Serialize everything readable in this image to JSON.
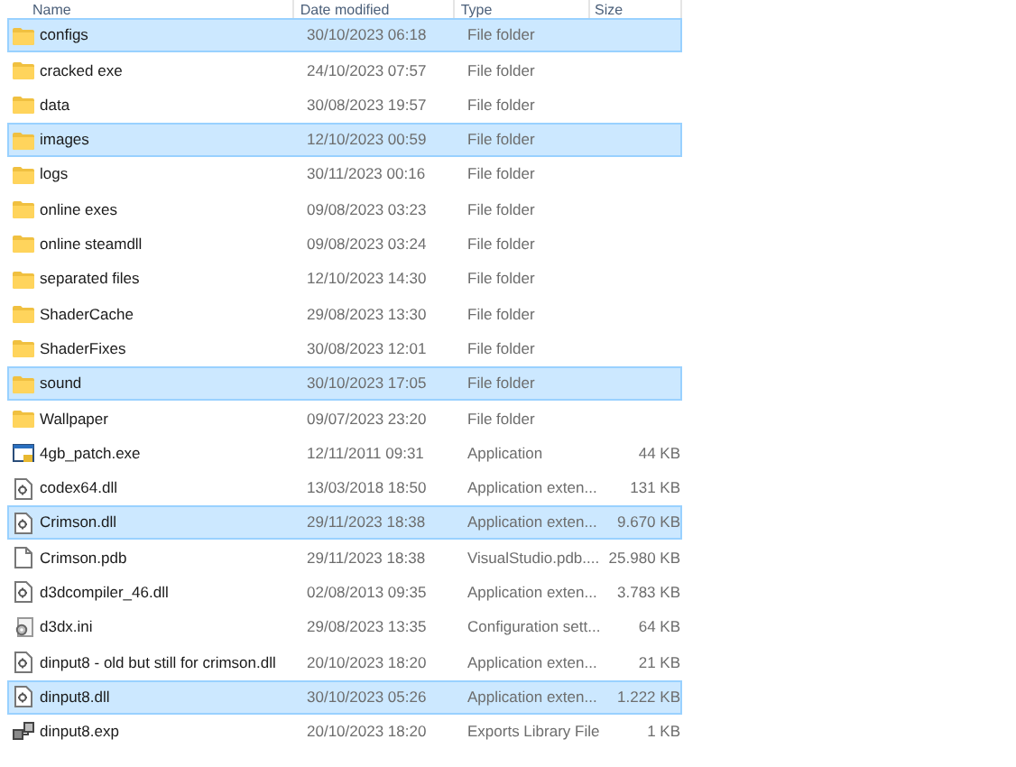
{
  "columns": [
    "Name",
    "Date modified",
    "Type",
    "Size"
  ],
  "rows": [
    {
      "kind": "folder",
      "name": "configs",
      "date": "30/10/2023 06:18",
      "type": "File folder",
      "selected": true
    },
    {
      "kind": "folder",
      "name": "cracked exe",
      "date": "24/10/2023 07:57",
      "type": "File folder",
      "selected": false
    },
    {
      "kind": "folder",
      "name": "data",
      "date": "30/08/2023 19:57",
      "type": "File folder",
      "selected": false
    },
    {
      "kind": "folder",
      "name": "images",
      "date": "12/10/2023 00:59",
      "type": "File folder",
      "selected": true
    },
    {
      "kind": "folder",
      "name": "logs",
      "date": "30/11/2023 00:16",
      "type": "File folder",
      "selected": false
    },
    {
      "kind": "folder",
      "name": "online exes",
      "date": "09/08/2023 03:23",
      "type": "File folder",
      "selected": false
    },
    {
      "kind": "folder",
      "name": "online steamdll",
      "date": "09/08/2023 03:24",
      "type": "File folder",
      "selected": false
    },
    {
      "kind": "folder",
      "name": "separated files",
      "date": "12/10/2023 14:30",
      "type": "File folder",
      "selected": false
    },
    {
      "kind": "folder",
      "name": "ShaderCache",
      "date": "29/08/2023 13:30",
      "type": "File folder",
      "selected": false
    },
    {
      "kind": "folder",
      "name": "ShaderFixes",
      "date": "30/08/2023 12:01",
      "type": "File folder",
      "selected": false
    },
    {
      "kind": "folder",
      "name": "sound",
      "date": "30/10/2023 17:05",
      "type": "File folder",
      "selected": true
    },
    {
      "kind": "folder",
      "name": "Wallpaper",
      "date": "09/07/2023 23:20",
      "type": "File folder",
      "selected": false
    },
    {
      "kind": "application",
      "name": "4gb_patch.exe",
      "date": "12/11/2011 09:31",
      "type": "Application",
      "size": "44 KB",
      "selected": false
    },
    {
      "kind": "dll",
      "name": "codex64.dll",
      "date": "13/03/2018 18:50",
      "type": "Application exten...",
      "size": "131 KB",
      "selected": false
    },
    {
      "kind": "dll",
      "name": "Crimson.dll",
      "date": "29/11/2023 18:38",
      "type": "Application exten...",
      "size": "9.670 KB",
      "selected": true
    },
    {
      "kind": "file",
      "name": "Crimson.pdb",
      "date": "29/11/2023 18:38",
      "type": "VisualStudio.pdb....",
      "size": "25.980 KB",
      "selected": false
    },
    {
      "kind": "dll",
      "name": "d3dcompiler_46.dll",
      "date": "02/08/2013 09:35",
      "type": "Application exten...",
      "size": "3.783 KB",
      "selected": false
    },
    {
      "kind": "settings",
      "name": "d3dx.ini",
      "date": "29/08/2023 13:35",
      "type": "Configuration sett...",
      "size": "64 KB",
      "selected": false
    },
    {
      "kind": "dll",
      "name": "dinput8 - old but still for crimson.dll",
      "date": "20/10/2023 18:20",
      "type": "Application exten...",
      "size": "21 KB",
      "selected": false
    },
    {
      "kind": "dll",
      "name": "dinput8.dll",
      "date": "30/10/2023 05:26",
      "type": "Application exten...",
      "size": "1.222 KB",
      "selected": true
    },
    {
      "kind": "exports",
      "name": "dinput8.exp",
      "date": "20/10/2023 18:20",
      "type": "Exports Library File",
      "size": "1 KB",
      "selected": false
    }
  ]
}
